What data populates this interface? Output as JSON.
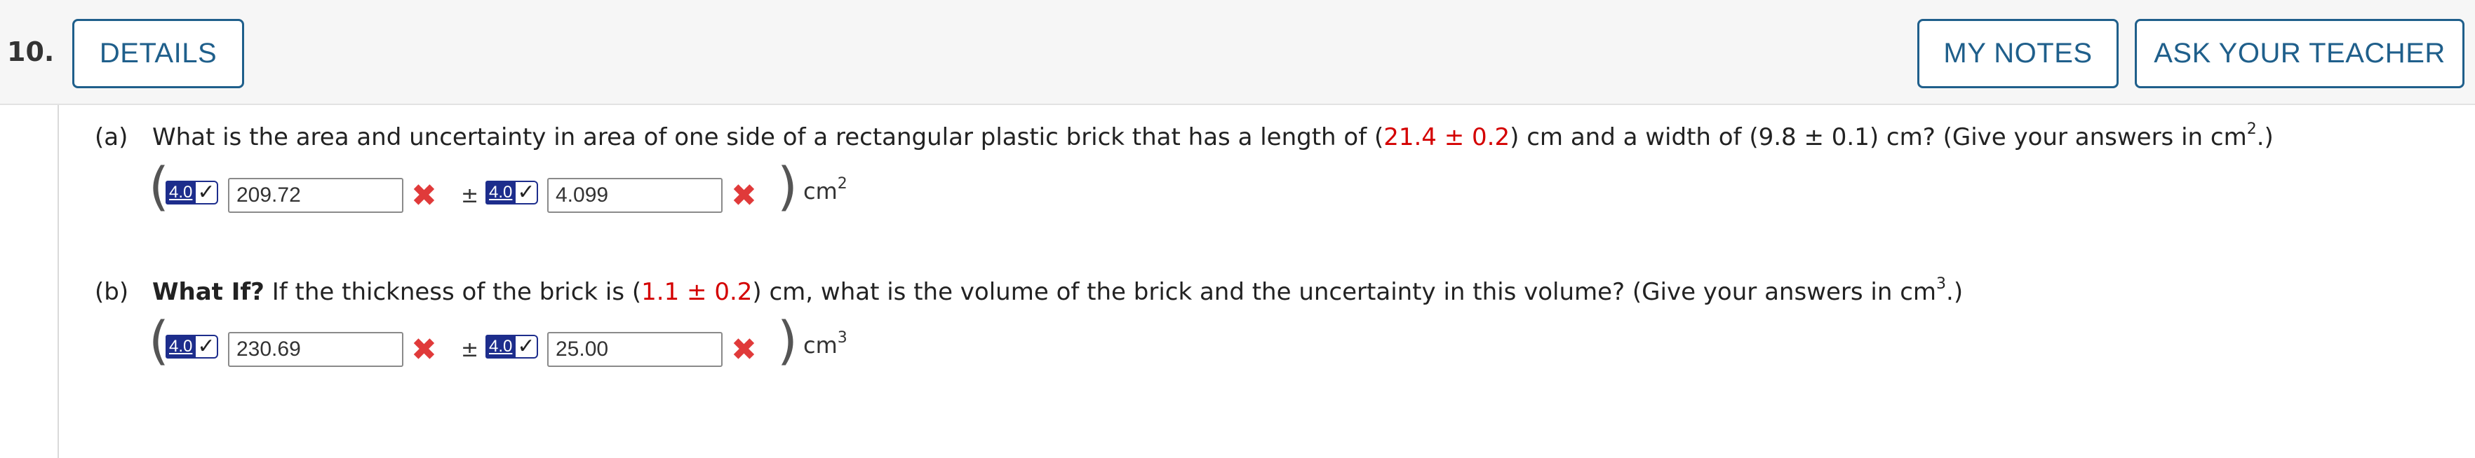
{
  "header": {
    "question_number": "10.",
    "details_label": "DETAILS",
    "my_notes_label": "MY NOTES",
    "ask_teacher_label": "ASK YOUR TEACHER"
  },
  "parts": [
    {
      "label": "(a)",
      "text_1": "What is the area and uncertainty in area of one side of a rectangular plastic brick that has a length of (",
      "length_value": "21.4 ± 0.2",
      "text_2": ") cm and a width of (9.8 ± 0.1) cm? (Give your answers in cm",
      "exponent": "2",
      "text_3": ".)",
      "badge_value": "4.0",
      "answer_value": "209.72",
      "plusminus": "±",
      "uncertainty_value": "4.099",
      "unit": "cm",
      "unit_exponent": "2"
    },
    {
      "label": "(b)",
      "bold_lead": "What If?",
      "text_1": " If the thickness of the brick is (",
      "thickness_value": "1.1 ± 0.2",
      "text_2": ") cm, what is the volume of the brick and the uncertainty in this volume? (Give your answers in cm",
      "exponent": "3",
      "text_3": ".)",
      "badge_value": "4.0",
      "answer_value": "230.69",
      "plusminus": "±",
      "uncertainty_value": "25.00",
      "unit": "cm",
      "unit_exponent": "3"
    }
  ],
  "colors": {
    "accent_blue": "#1f5f8b",
    "error_red": "#e03a3a",
    "given_red": "#d40000",
    "badge_navy": "#1d2d8c"
  }
}
